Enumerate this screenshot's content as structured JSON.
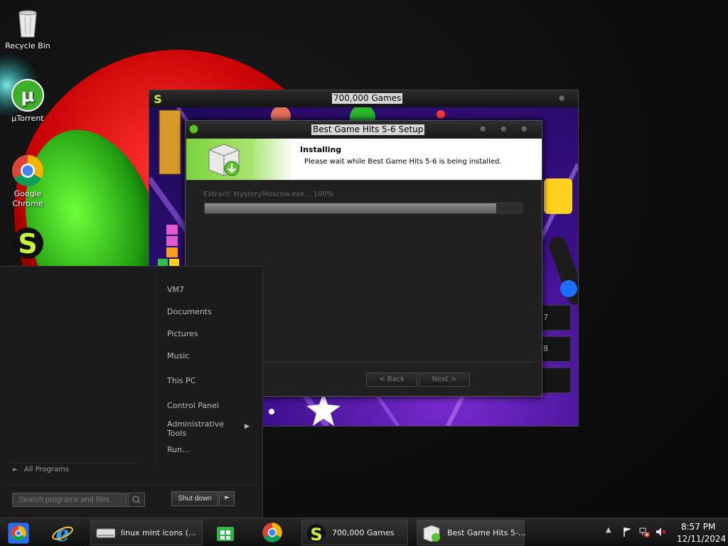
{
  "desktop": {
    "icons": [
      {
        "label": "Recycle Bin"
      },
      {
        "label": "µTorrent"
      },
      {
        "label": "Google Chrome"
      }
    ]
  },
  "game_window": {
    "title": "700,000 Games",
    "side_buttons": [
      "7",
      "8",
      ""
    ]
  },
  "setup_dialog": {
    "title": "Best Game Hits 5-6 Setup",
    "header_title": "Installing",
    "header_subtitle": "Please wait while Best Game Hits 5-6 is being installed.",
    "status_text": "Extract: MysteryMoscow.exe... 100%",
    "progress_fraction": 0.92,
    "back_label": "< Back",
    "next_label": "Next >"
  },
  "start_menu": {
    "items": [
      "VM7",
      "Documents",
      "Pictures",
      "Music",
      "This PC",
      "Control Panel",
      "Administrative Tools",
      "Run..."
    ],
    "all_programs": "All Programs",
    "search_placeholder": "Search programs and files",
    "shutdown_label": "Shut down"
  },
  "taskbar": {
    "buttons": [
      {
        "label": "linux mint icons (..."
      },
      {
        "label": "700,000 Games"
      },
      {
        "label": "Best Game Hits 5-..."
      }
    ],
    "time": "8:57 PM",
    "date": "12/11/2024"
  },
  "colors": {
    "accent_green": "#7bd43a",
    "window_dark": "#202020"
  }
}
